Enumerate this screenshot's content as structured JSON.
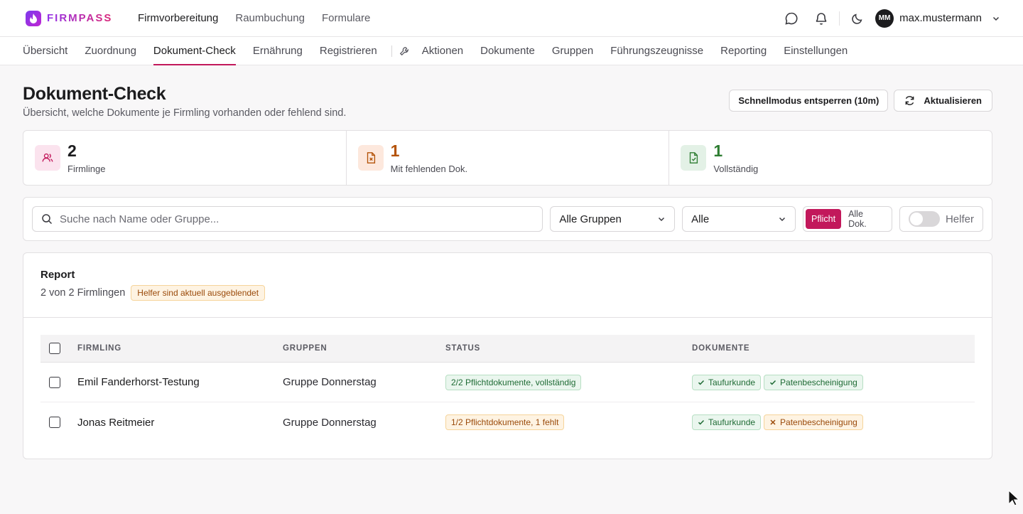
{
  "app": {
    "logo_text": "FIRMPASS"
  },
  "main_nav": [
    "Firmvorbereitung",
    "Raumbuchung",
    "Formulare"
  ],
  "user": {
    "initials": "MM",
    "name": "max.mustermann"
  },
  "sub_nav": {
    "tabs_left": [
      "Übersicht",
      "Zuordnung",
      "Dokument-Check",
      "Ernährung",
      "Registrieren"
    ],
    "tabs_right": [
      "Aktionen",
      "Dokumente",
      "Gruppen",
      "Führungszeugnisse",
      "Reporting",
      "Einstellungen"
    ],
    "active": "Dokument-Check"
  },
  "page": {
    "title": "Dokument-Check",
    "subtitle": "Übersicht, welche Dokumente je Firmling vorhanden oder fehlend sind.",
    "unlock_button": "Schnellmodus entsperren (10m)",
    "refresh_button": "Aktualisieren"
  },
  "stats": [
    {
      "value": "2",
      "label": "Firmlinge",
      "color": "#1c1c1e",
      "icon": "users-icon"
    },
    {
      "value": "1",
      "label": "Mit fehlenden Dok.",
      "color": "#b45309",
      "icon": "file-x-icon"
    },
    {
      "value": "1",
      "label": "Vollständig",
      "color": "#2e7d32",
      "icon": "file-check-icon"
    }
  ],
  "filters": {
    "search_placeholder": "Suche nach Name oder Gruppe...",
    "group_select": "Alle Gruppen",
    "status_select": "Alle",
    "seg_pflicht": "Pflicht",
    "seg_alle": "Alle Dok.",
    "helfer_label": "Helfer"
  },
  "report": {
    "title": "Report",
    "count": "2 von 2 Firmlingen",
    "badge": "Helfer sind aktuell ausgeblendet",
    "columns": [
      "FIRMLING",
      "GRUPPEN",
      "STATUS",
      "DOKUMENTE"
    ],
    "rows": [
      {
        "name": "Emil Fanderhorst-Testung",
        "group": "Gruppe Donnerstag",
        "status": "2/2 Pflichtdokumente, vollständig",
        "status_ok": true,
        "docs": [
          {
            "label": "Taufurkunde",
            "ok": true
          },
          {
            "label": "Patenbescheinigung",
            "ok": true
          }
        ]
      },
      {
        "name": "Jonas Reitmeier",
        "group": "Gruppe Donnerstag",
        "status": "1/2 Pflichtdokumente, 1 fehlt",
        "status_ok": false,
        "docs": [
          {
            "label": "Taufurkunde",
            "ok": true
          },
          {
            "label": "Patenbescheinigung",
            "ok": false
          }
        ]
      }
    ]
  },
  "colors": {
    "accent": "#c2185b",
    "ok": "#1f6b35",
    "warn": "#9a4a0a"
  }
}
